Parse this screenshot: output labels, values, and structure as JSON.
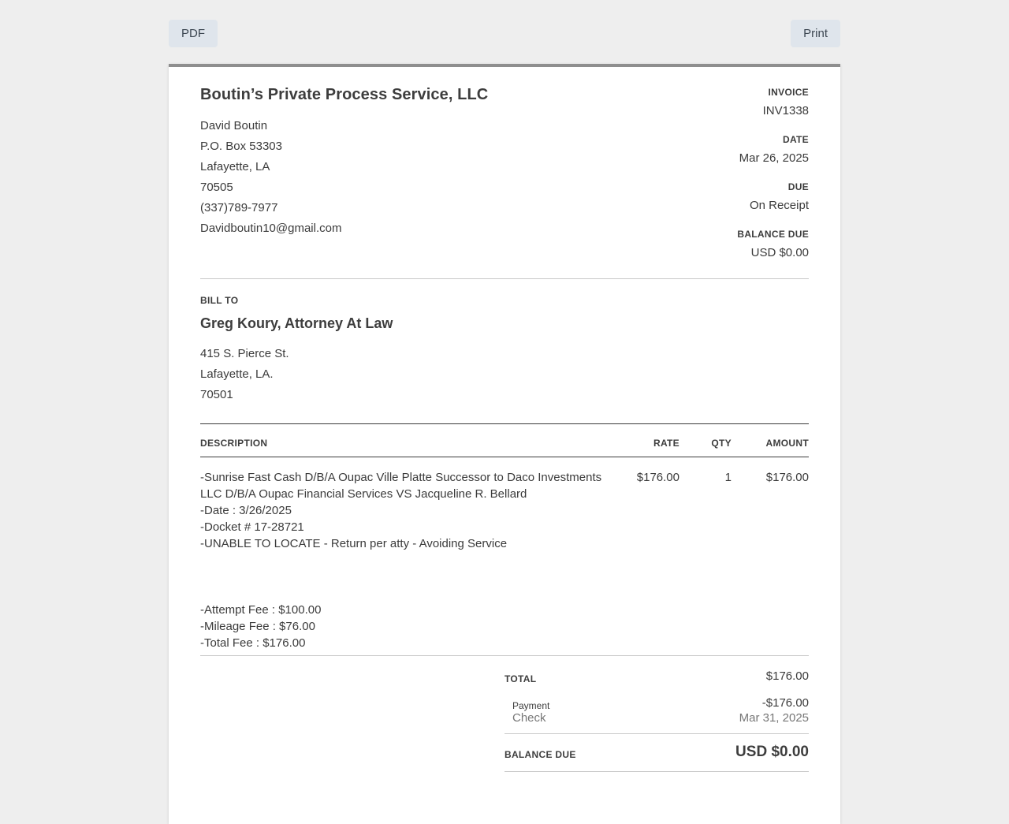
{
  "toolbar": {
    "pdf_label": "PDF",
    "print_label": "Print"
  },
  "from": {
    "company": "Boutin’s Private Process Service, LLC",
    "lines": [
      "David Boutin",
      "P.O. Box 53303",
      "Lafayette, LA",
      "70505",
      "(337)789-7977",
      "Davidboutin10@gmail.com"
    ]
  },
  "meta": {
    "invoice_label": "INVOICE",
    "invoice_value": "INV1338",
    "date_label": "DATE",
    "date_value": "Mar 26, 2025",
    "due_label": "DUE",
    "due_value": "On Receipt",
    "balance_label": "BALANCE DUE",
    "balance_value": "USD $0.00"
  },
  "bill_to": {
    "label": "BILL TO",
    "name": "Greg Koury, Attorney At Law",
    "lines": [
      "415 S. Pierce St.",
      "Lafayette, LA.",
      "70501"
    ]
  },
  "table": {
    "headers": {
      "description": "DESCRIPTION",
      "rate": "RATE",
      "qty": "QTY",
      "amount": "AMOUNT"
    },
    "item": {
      "description_lines": [
        "-Sunrise Fast Cash D/B/A Oupac Ville Platte Successor to Daco Investments",
        "LLC D/B/A Oupac Financial Services VS Jacqueline R. Bellard",
        "-Date : 3/26/2025",
        "-Docket # 17-28721",
        "-UNABLE TO LOCATE - Return per atty - Avoiding Service",
        "",
        "",
        "",
        "-Attempt Fee : $100.00",
        "-Mileage Fee : $76.00",
        "-Total Fee : $176.00"
      ],
      "rate": "$176.00",
      "qty": "1",
      "amount": "$176.00"
    }
  },
  "totals": {
    "total_label": "TOTAL",
    "total_value": "$176.00",
    "payment_label": "Payment",
    "payment_method": "Check",
    "payment_value": "-$176.00",
    "payment_date": "Mar 31, 2025",
    "balance_label": "BALANCE DUE",
    "balance_value": "USD $0.00"
  }
}
